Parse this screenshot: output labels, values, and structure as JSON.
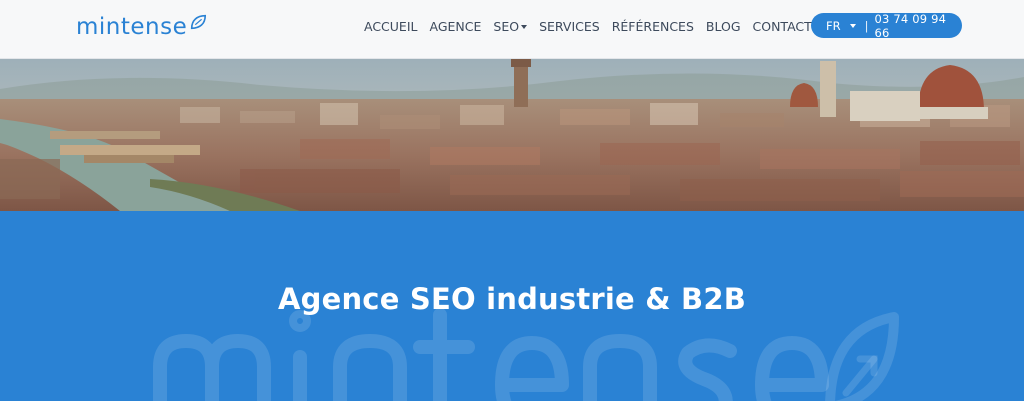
{
  "brand": {
    "name": "mintense"
  },
  "nav": {
    "items": [
      {
        "label": "ACCUEIL"
      },
      {
        "label": "AGENCE"
      },
      {
        "label": "SEO"
      },
      {
        "label": "SERVICES"
      },
      {
        "label": "RÉFÉRENCES"
      },
      {
        "label": "BLOG"
      },
      {
        "label": "CONTACT"
      }
    ]
  },
  "contact_pill": {
    "language": "FR",
    "separator": "|",
    "phone": "03 74 09 94 66"
  },
  "hero": {
    "image_alt": "Panorama of Florence"
  },
  "band": {
    "title": "Agence SEO industrie & B2B"
  },
  "colors": {
    "brand_blue": "#2a82d4",
    "nav_text": "#3d4a5c",
    "header_bg": "#f7f8f9"
  }
}
